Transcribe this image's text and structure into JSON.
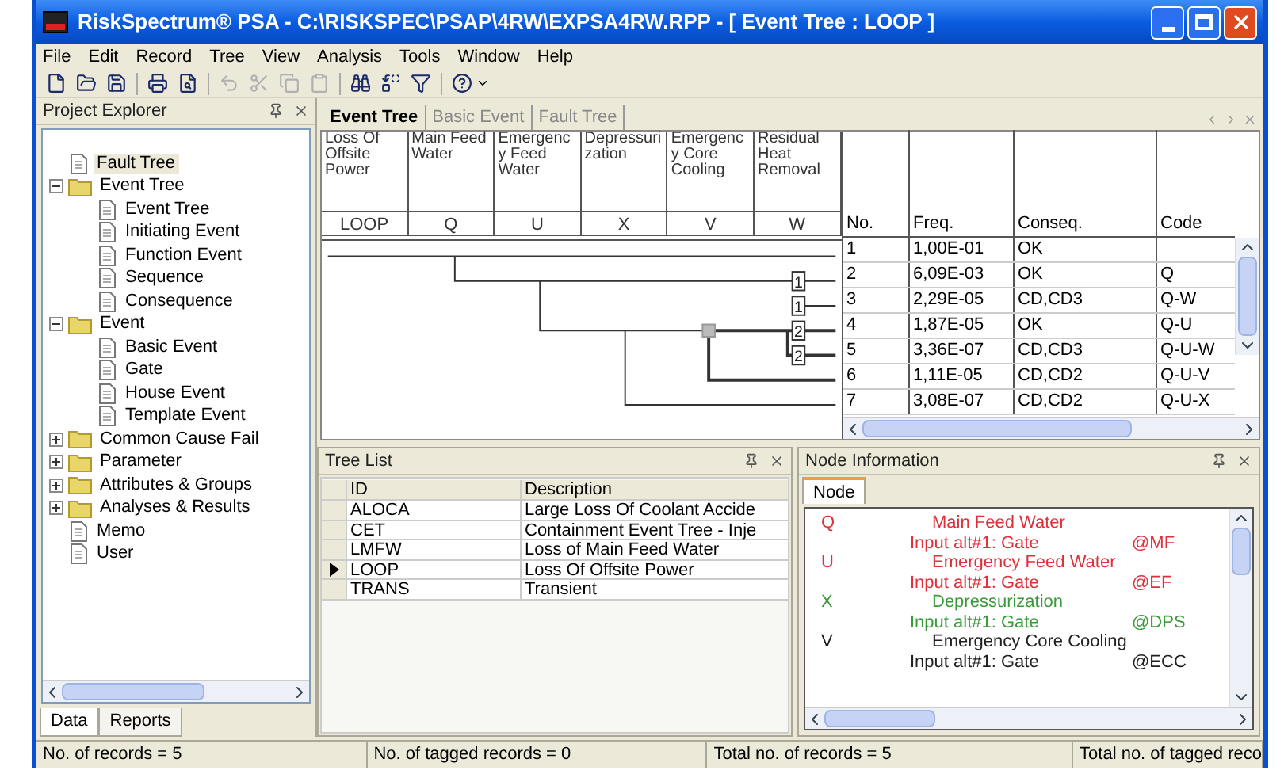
{
  "window": {
    "title": "RiskSpectrum® PSA - C:\\RISKSPEC\\PSAP\\4RW\\EXPSA4RW.RPP - [ Event Tree : LOOP ]"
  },
  "menu": [
    "File",
    "Edit",
    "Record",
    "Tree",
    "View",
    "Analysis",
    "Tools",
    "Window",
    "Help"
  ],
  "project_explorer": {
    "title": "Project Explorer",
    "items": [
      {
        "label": "Fault Tree",
        "kind": "document",
        "selected": true
      },
      {
        "label": "Event Tree",
        "kind": "folder",
        "expanded": true,
        "selected": false,
        "children": [
          {
            "label": "Event Tree",
            "kind": "document",
            "selected": false
          },
          {
            "label": "Initiating Event",
            "kind": "document",
            "selected": false
          },
          {
            "label": "Function Event",
            "kind": "document",
            "selected": false
          },
          {
            "label": "Sequence",
            "kind": "document",
            "selected": false
          },
          {
            "label": "Consequence",
            "kind": "document",
            "selected": false
          }
        ]
      },
      {
        "label": "Event",
        "kind": "folder",
        "expanded": true,
        "selected": false,
        "children": [
          {
            "label": "Basic Event",
            "kind": "document",
            "selected": false
          },
          {
            "label": "Gate",
            "kind": "document",
            "selected": false
          },
          {
            "label": "House Event",
            "kind": "document",
            "selected": false
          },
          {
            "label": "Template Event",
            "kind": "document",
            "selected": false
          }
        ]
      },
      {
        "label": "Common Cause Fail",
        "kind": "folder",
        "expanded": false,
        "selected": false
      },
      {
        "label": "Parameter",
        "kind": "folder",
        "expanded": false,
        "selected": false
      },
      {
        "label": "Attributes & Groups",
        "kind": "folder",
        "expanded": false,
        "selected": false
      },
      {
        "label": "Analyses & Results",
        "kind": "folder",
        "expanded": false,
        "selected": false
      },
      {
        "label": "Memo",
        "kind": "document",
        "selected": false
      },
      {
        "label": "User",
        "kind": "document",
        "selected": false
      }
    ],
    "tabs": [
      {
        "label": "Data",
        "selected": true
      },
      {
        "label": "Reports",
        "selected": false
      }
    ]
  },
  "document_tabs": [
    {
      "label": "Event Tree",
      "selected": true
    },
    {
      "label": "Basic Event",
      "selected": false
    },
    {
      "label": "Fault Tree",
      "selected": false
    }
  ],
  "event_tree": {
    "columns": [
      {
        "heading": "Loss Of Offsite Power",
        "code": "LOOP"
      },
      {
        "heading": "Main Feed Water",
        "code": "Q"
      },
      {
        "heading": "Emergency Feed Water",
        "code": "U"
      },
      {
        "heading": "Depressurization",
        "code": "X"
      },
      {
        "heading": "Emergency Core Cooling",
        "code": "V"
      },
      {
        "heading": "Residual Heat Removal",
        "code": "W"
      }
    ],
    "sequence_columns": [
      "No.",
      "Freq.",
      "Conseq.",
      "Code"
    ],
    "sequences": [
      {
        "no": "1",
        "freq": "1,00E-01",
        "conseq": "OK"
      },
      {
        "no": "2",
        "freq": "6,09E-03",
        "conseq": "OK",
        "code": "Q",
        "transfer": "1"
      },
      {
        "no": "3",
        "freq": "2,29E-05",
        "conseq": "CD,CD3",
        "code": "Q-W",
        "transfer": "1"
      },
      {
        "no": "4",
        "freq": "1,87E-05",
        "conseq": "OK",
        "code": "Q-U",
        "transfer": "2"
      },
      {
        "no": "5",
        "freq": "3,36E-07",
        "conseq": "CD,CD3",
        "code": "Q-U-W",
        "transfer": "2"
      },
      {
        "no": "6",
        "freq": "1,11E-05",
        "conseq": "CD,CD2",
        "code": "Q-U-V"
      },
      {
        "no": "7",
        "freq": "3,08E-07",
        "conseq": "CD,CD2",
        "code": "Q-U-X"
      }
    ]
  },
  "tree_list": {
    "title": "Tree List",
    "columns": [
      "ID",
      "Description"
    ],
    "rows": [
      {
        "id": "ALOCA",
        "description": "Large Loss Of Coolant Accide",
        "selected": false
      },
      {
        "id": "CET",
        "description": "Containment Event Tree - Inje",
        "selected": false
      },
      {
        "id": "LMFW",
        "description": "Loss of Main Feed Water",
        "selected": false
      },
      {
        "id": "LOOP",
        "description": "Loss Of Offsite Power",
        "selected": true
      },
      {
        "id": "TRANS",
        "description": "Transient",
        "selected": false
      }
    ]
  },
  "node_information": {
    "title": "Node Information",
    "tab": "Node",
    "nodes": [
      {
        "code": "Q",
        "title": "Main Feed Water",
        "input": "Input alt#1:  Gate",
        "ref": "@MF",
        "color": "#e0303a"
      },
      {
        "code": "U",
        "title": "Emergency Feed Water",
        "input": "Input alt#1:  Gate",
        "ref": "@EF",
        "color": "#e0303a"
      },
      {
        "code": "X",
        "title": "Depressurization",
        "input": "Input alt#1:  Gate",
        "ref": "@DPS",
        "color": "#3a9a3a"
      },
      {
        "code": "V",
        "title": "Emergency Core Cooling",
        "input": "Input alt#1:  Gate",
        "ref": "@ECC",
        "color": "#202020"
      }
    ]
  },
  "status_bar": [
    "No. of records = 5",
    "No. of tagged records = 0",
    "Total no. of records = 5",
    "Total no. of tagged reco"
  ]
}
